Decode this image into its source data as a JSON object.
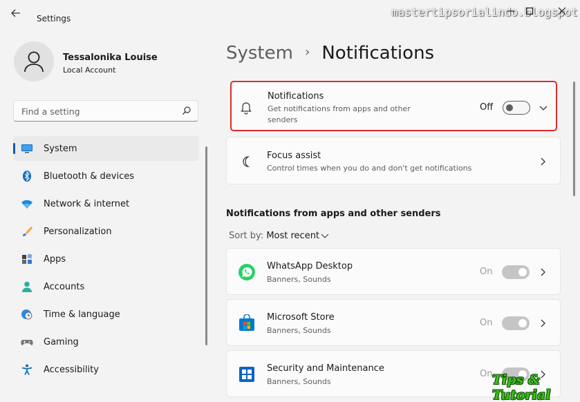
{
  "window": {
    "app_title": "Settings",
    "watermark": "mastertipsorialindo.blogspot.com"
  },
  "user": {
    "name": "Tessalonika Louise",
    "account_type": "Local Account"
  },
  "search": {
    "placeholder": "Find a setting"
  },
  "nav": {
    "items": [
      {
        "label": "System",
        "icon": "system-icon",
        "active": true
      },
      {
        "label": "Bluetooth & devices",
        "icon": "bluetooth-icon"
      },
      {
        "label": "Network & internet",
        "icon": "wifi-icon"
      },
      {
        "label": "Personalization",
        "icon": "brush-icon"
      },
      {
        "label": "Apps",
        "icon": "apps-icon"
      },
      {
        "label": "Accounts",
        "icon": "accounts-icon"
      },
      {
        "label": "Time & language",
        "icon": "clock-globe-icon"
      },
      {
        "label": "Gaming",
        "icon": "gamepad-icon"
      },
      {
        "label": "Accessibility",
        "icon": "accessibility-icon"
      }
    ]
  },
  "breadcrumb": {
    "parent": "System",
    "separator": "›",
    "current": "Notifications"
  },
  "notifications_card": {
    "title": "Notifications",
    "subtitle_line1": "Get notifications from apps and other",
    "subtitle_line2": "senders",
    "state": "Off",
    "icon": "bell-icon"
  },
  "focus_card": {
    "title": "Focus assist",
    "subtitle": "Control times when you do and don't get notifications",
    "icon": "moon-icon"
  },
  "apps_section": {
    "title": "Notifications from apps and other senders",
    "sort_label": "Sort by:",
    "sort_value": "Most recent",
    "apps": [
      {
        "name": "WhatsApp Desktop",
        "detail": "Banners, Sounds",
        "state": "On",
        "icon": "whatsapp-icon"
      },
      {
        "name": "Microsoft Store",
        "detail": "Banners, Sounds",
        "state": "On",
        "icon": "store-icon"
      },
      {
        "name": "Security and Maintenance",
        "detail": "Banners, Sounds",
        "state": "On",
        "icon": "security-icon"
      }
    ]
  },
  "overlay_badge": "Tips & Tutorial",
  "colors": {
    "accent": "#005fb8",
    "highlight_border": "#d92b2b",
    "whatsapp_green": "#25d366",
    "store_blue": "#0078d4"
  }
}
